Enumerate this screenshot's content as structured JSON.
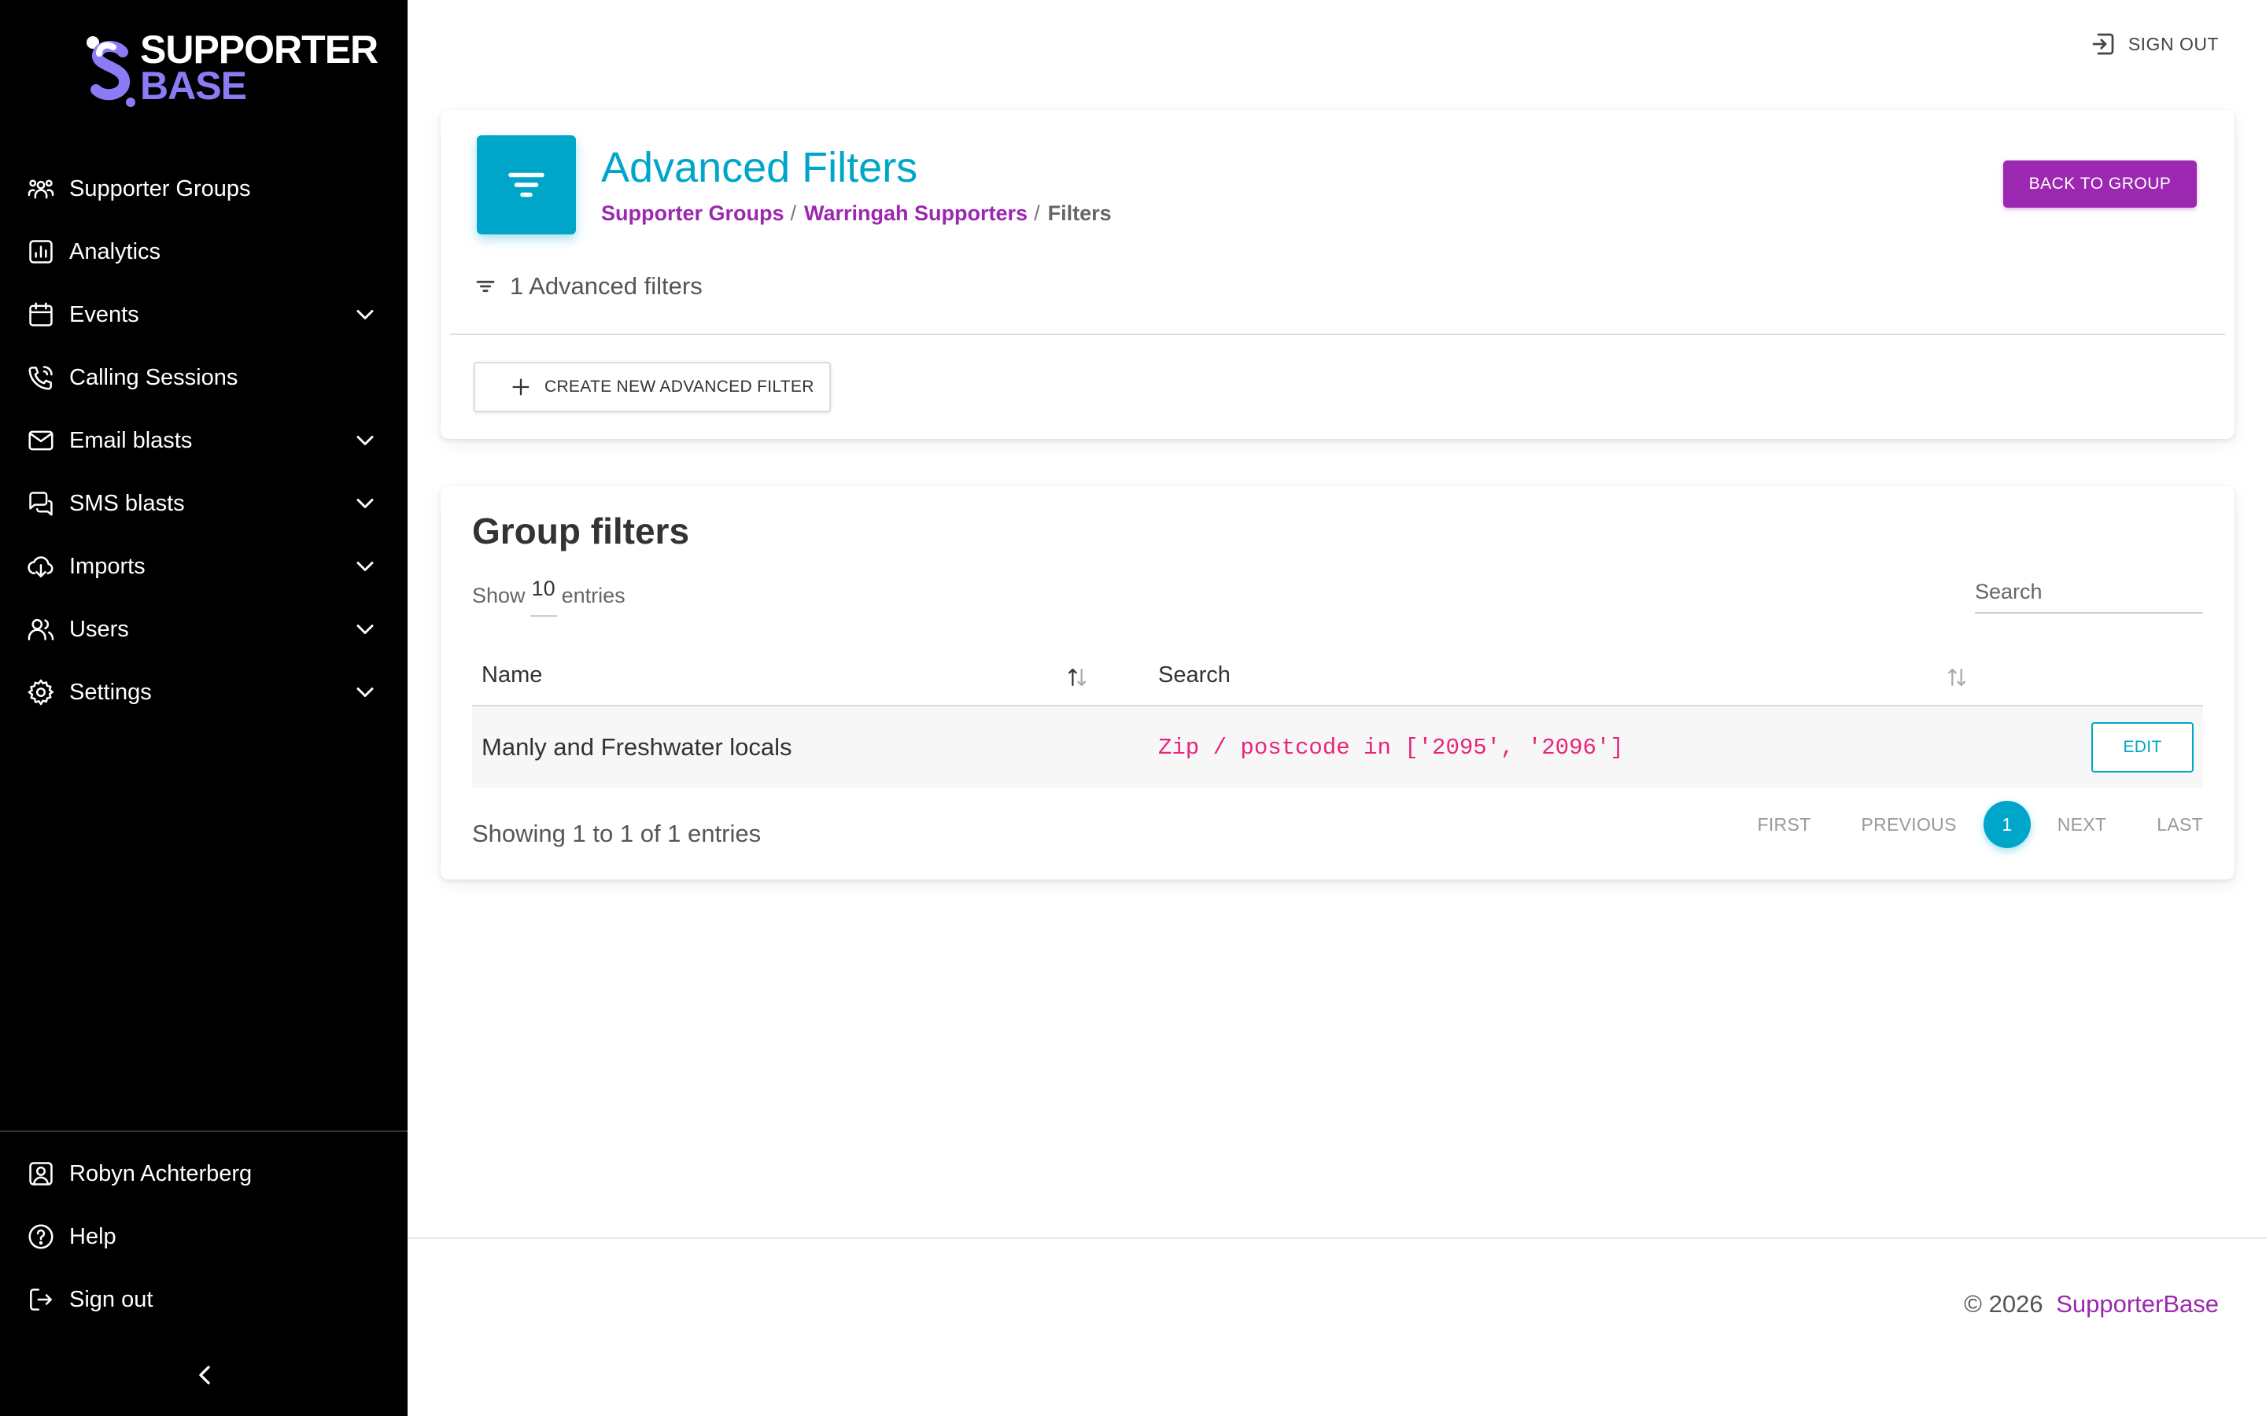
{
  "app": {
    "logo_line1": "SUPPORTER",
    "logo_line2": "BASE",
    "brand_color": "#8b7cf6",
    "accent_color": "#00a6c9",
    "secondary_color": "#9c27b0"
  },
  "sidebar": {
    "items": [
      {
        "label": "Supporter Groups",
        "icon": "groups-icon",
        "expandable": false
      },
      {
        "label": "Analytics",
        "icon": "analytics-icon",
        "expandable": false
      },
      {
        "label": "Events",
        "icon": "calendar-icon",
        "expandable": true
      },
      {
        "label": "Calling Sessions",
        "icon": "phone-icon",
        "expandable": false
      },
      {
        "label": "Email blasts",
        "icon": "mail-icon",
        "expandable": true
      },
      {
        "label": "SMS blasts",
        "icon": "chat-icon",
        "expandable": true
      },
      {
        "label": "Imports",
        "icon": "cloud-download-icon",
        "expandable": true
      },
      {
        "label": "Users",
        "icon": "users-icon",
        "expandable": true
      },
      {
        "label": "Settings",
        "icon": "gear-icon",
        "expandable": true
      }
    ],
    "bottom": [
      {
        "label": "Robyn Achterberg",
        "icon": "user-portrait-icon"
      },
      {
        "label": "Help",
        "icon": "help-icon"
      },
      {
        "label": "Sign out",
        "icon": "logout-icon"
      }
    ]
  },
  "topbar": {
    "signout_label": "SIGN OUT"
  },
  "header": {
    "title": "Advanced Filters",
    "breadcrumb": [
      {
        "label": "Supporter Groups",
        "link": true
      },
      {
        "label": "Warringah Supporters",
        "link": true
      },
      {
        "label": "Filters",
        "link": false
      }
    ],
    "back_button": "BACK TO GROUP",
    "filter_count_label": "1 Advanced filters",
    "create_button": "CREATE NEW ADVANCED FILTER"
  },
  "group_filters": {
    "title": "Group filters",
    "show_label": "Show",
    "entries_value": "10",
    "entries_label": "entries",
    "search_placeholder": "Search",
    "columns": [
      "Name",
      "Search"
    ],
    "rows": [
      {
        "name": "Manly and Freshwater locals",
        "search": "Zip / postcode in ['2095', '2096']",
        "action": "EDIT"
      }
    ],
    "showing_text": "Showing 1 to 1 of 1 entries",
    "pagination": {
      "first": "FIRST",
      "previous": "PREVIOUS",
      "current": "1",
      "next": "NEXT",
      "last": "LAST"
    }
  },
  "footer": {
    "copyright": "© 2026",
    "brand_link": "SupporterBase"
  }
}
